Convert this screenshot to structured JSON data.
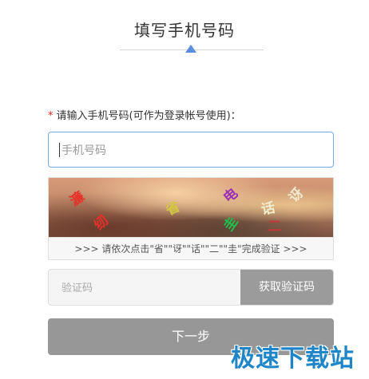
{
  "header": {
    "title": "填写手机号码"
  },
  "form": {
    "required_mark": "*",
    "phone_label": "请输入手机号码(可作为登录帐号使用)：",
    "phone_placeholder": "手机号码",
    "captcha": {
      "chars": [
        {
          "text": "濂",
          "color": "#e8302a"
        },
        {
          "text": "省",
          "color": "#d4c840"
        },
        {
          "text": "电",
          "color": "#9a2fb8"
        },
        {
          "text": "话",
          "color": "#f0f0d0"
        },
        {
          "text": "讶",
          "color": "#f2ead0"
        },
        {
          "text": "纫",
          "color": "#e8302a"
        },
        {
          "text": "圭",
          "color": "#20c050"
        },
        {
          "text": "二",
          "color": "#c03838"
        }
      ],
      "hint": ">>> 请依次点击\"省\"\"讶\"\"话\"\"二\"\"圭\"完成验证 >>>"
    },
    "code_placeholder": "验证码",
    "get_code_label": "获取验证码",
    "next_label": "下一步"
  },
  "watermark": "极速下载站",
  "colors": {
    "accent": "#5a8fe0",
    "required": "#e02020",
    "button_disabled": "#979797",
    "watermark": "#1e86c8"
  }
}
